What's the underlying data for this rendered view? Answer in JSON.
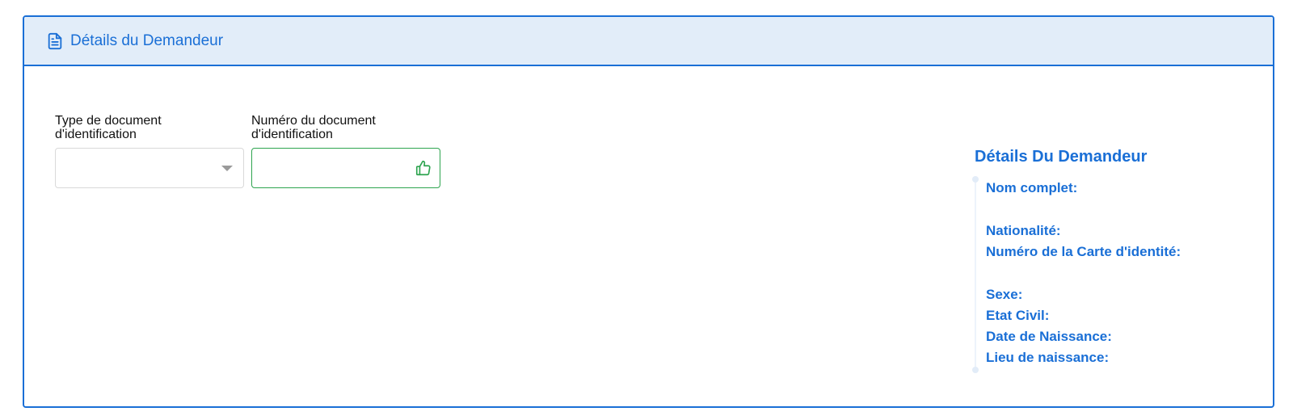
{
  "section": {
    "title": "Détails du Demandeur",
    "icon": "document-icon",
    "accent_color": "#1a6fd6",
    "header_bg": "#e2edf9"
  },
  "form": {
    "doc_type": {
      "label": "Type de document d'identification",
      "value": ""
    },
    "doc_number": {
      "label": "Numéro du document d'identification",
      "value": "",
      "icon": "thumbs-up-icon",
      "valid_color": "#2ea44f"
    }
  },
  "summary": {
    "title": "Détails Du Demandeur",
    "fields": {
      "full_name": "Nom complet:",
      "nationality": "Nationalité:",
      "id_card_number": "Numéro de la Carte d'identité:",
      "sex": "Sexe:",
      "civil_status": "Etat Civil:",
      "birth_date": "Date de Naissance:",
      "birth_place": "Lieu de naissance:"
    }
  }
}
